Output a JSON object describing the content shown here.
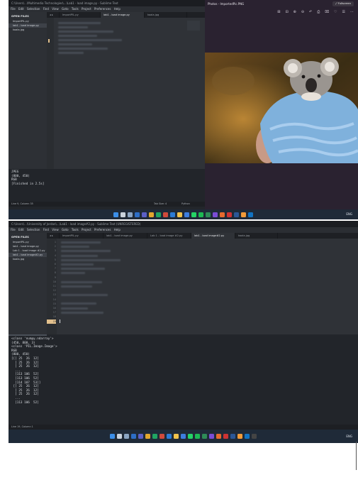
{
  "shot1": {
    "title": "C:\\Users\\...\\Multimedia Technologies\\...\\Lab1 - load image.py - Sublime Text",
    "menu": [
      "File",
      "Edit",
      "Selection",
      "Find",
      "View",
      "Goto",
      "Tools",
      "Project",
      "Preferences",
      "Help"
    ],
    "sidebar": {
      "heading": "OPEN FILES",
      "items": [
        "ImportPIL.py",
        "lab1 - load image.py",
        "koala.jpg"
      ]
    },
    "tabs": [
      "ImportPIL.py",
      "lab1 - load image.py",
      "koala.jpg"
    ],
    "console": [
      "JPEG",
      "(800, 450)",
      "RGB",
      "[Finished in 2.5s]"
    ],
    "status": {
      "left": "Line 9, Column 35",
      "tab": "Tab Size: 4",
      "lang": "Python"
    },
    "photos": {
      "title": "Photos - ImportedPic.PNG",
      "fullscreen": "Fullscreen",
      "tools": [
        "⊞",
        "⊟",
        "⊕",
        "⊖",
        "↶",
        "⎙",
        "⌧",
        "♡",
        "☰",
        "⋯"
      ]
    }
  },
  "shot2": {
    "title": "C:\\Users\\...\\University of Jordan\\...\\Lab1 - load image#2.py - Sublime Text (UNREGISTERED)",
    "menu": [
      "File",
      "Edit",
      "Selection",
      "Find",
      "View",
      "Goto",
      "Tools",
      "Project",
      "Preferences",
      "Help"
    ],
    "sidebar": {
      "heading": "OPEN FILES",
      "items": [
        "ImportPIL.py",
        "lab1 - load image.py",
        "Lab 1 - load image #2.py",
        "lab1 - load image#2.py",
        "koala.jpg"
      ]
    },
    "tabs": [
      "ImportPIL.py",
      "lab1 - load image.py",
      "Lab 1 - load image #2.py",
      "lab1 - load image#2.py",
      "koala.jpg"
    ],
    "line_numbers": [
      "1",
      "2",
      "3",
      "4",
      "5",
      "6",
      "7",
      "8",
      "9",
      "10",
      "11",
      "12",
      "13",
      "14",
      "15",
      "16",
      "17",
      "18",
      "19"
    ],
    "console": [
      "<class 'numpy.ndarray'>",
      "(450, 800, 3)",
      "<class 'PIL.Image.Image'>",
      "RGB",
      "(800, 450)",
      "[[[ 25  26  12]",
      "  [ 25  26  12]",
      "  [ 25  26  12]",
      "  ...",
      "  [113 106  52]",
      "  [113 106  52]",
      "  [114 107  53]]",
      "",
      " [[ 25  26  12]",
      "  [ 25  26  12]",
      "  [ 25  26  12]",
      "  ...",
      "  [113 106  52]"
    ],
    "status": {
      "left": "Line 19, Column 1"
    }
  },
  "taskbar": {
    "lang": "ENG"
  },
  "colors": {
    "accent": "#e2c08d",
    "window": "#23262b",
    "editor": "#2f3237",
    "taskbar": "#1f2a38"
  }
}
